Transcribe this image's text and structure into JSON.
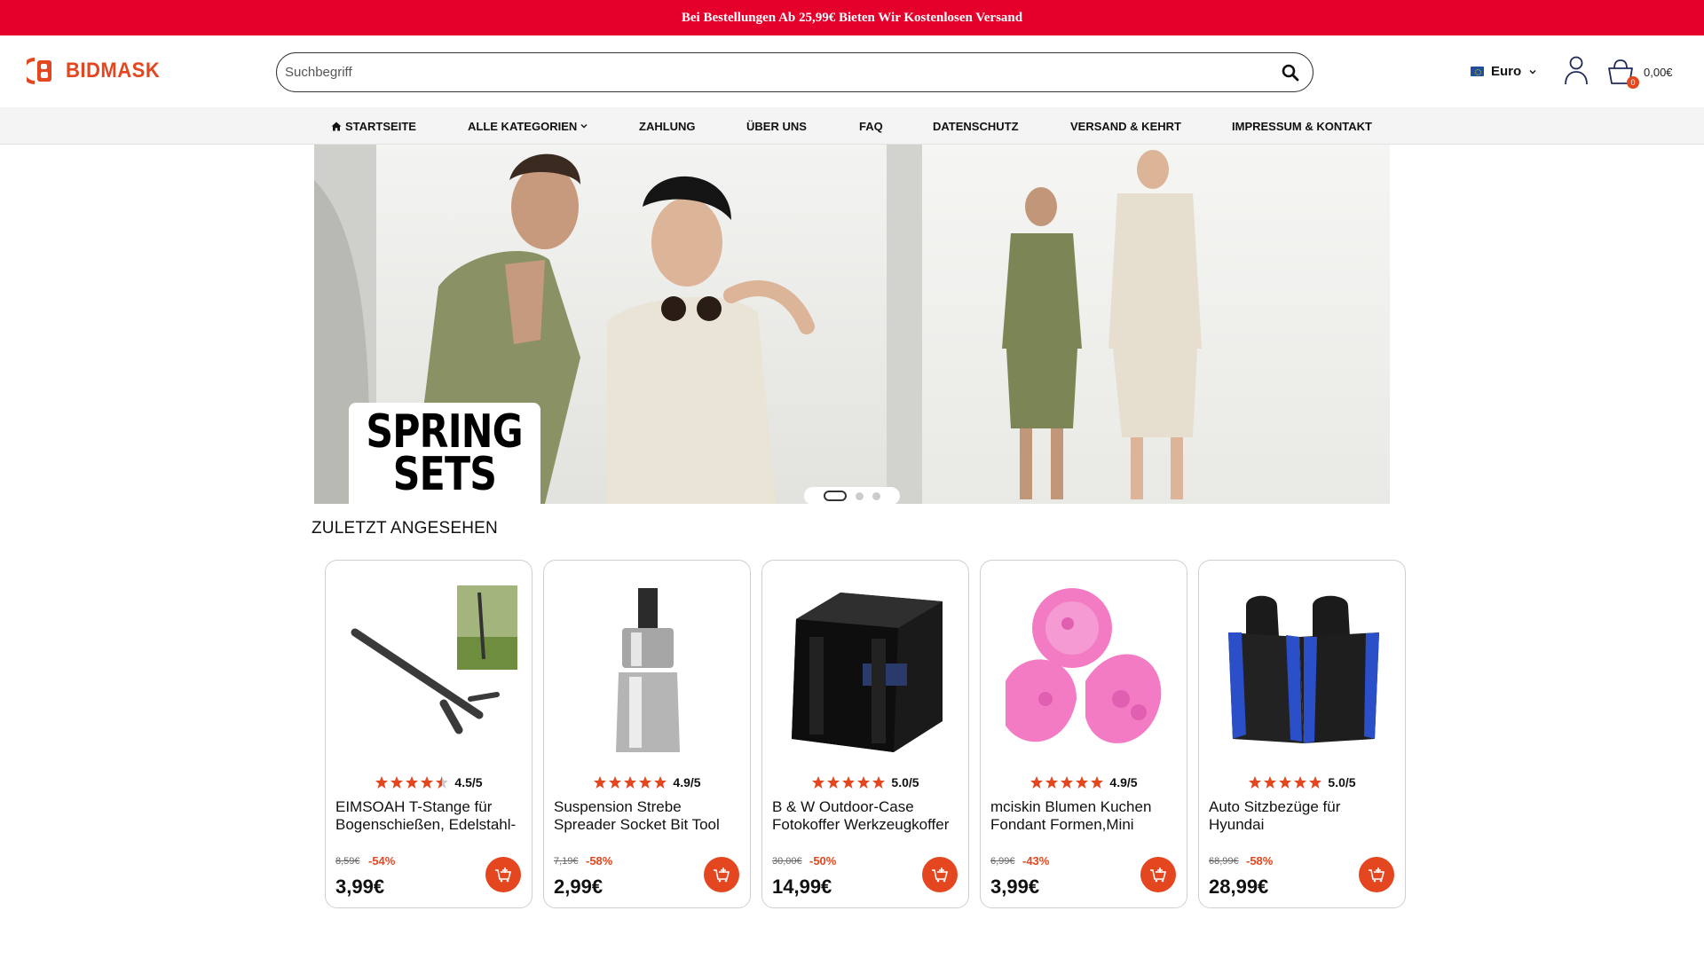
{
  "announcement": "Bei Bestellungen Ab 25,99€ Bieten Wir Kostenlosen Versand",
  "brand": {
    "name": "BIDMASK",
    "color": "#e4461f"
  },
  "search": {
    "placeholder": "Suchbegriff"
  },
  "currency": {
    "label": "Euro"
  },
  "cart": {
    "count": "0",
    "total": "0,00€"
  },
  "nav": [
    {
      "label": "STARTSEITE",
      "icon": "home-icon"
    },
    {
      "label": "ALLE KATEGORIEN",
      "icon": "chevron-down-icon"
    },
    {
      "label": "ZAHLUNG"
    },
    {
      "label": "ÜBER UNS"
    },
    {
      "label": "FAQ"
    },
    {
      "label": "DATENSCHUTZ"
    },
    {
      "label": "VERSAND & KEHRT"
    },
    {
      "label": "IMPRESSUM & KONTAKT"
    }
  ],
  "hero": {
    "badge_line1": "SPRING",
    "badge_line2": "SETS",
    "slides": 3,
    "active_slide": 1
  },
  "recent": {
    "title": "ZULETZT ANGESEHEN",
    "products": [
      {
        "name": "EIMSOAH T-Stange für Bogenschießen, Edelstahl-",
        "rating": 4.5,
        "rating_label": "4.5/5",
        "old_price": "8,59€",
        "discount": "-54%",
        "price": "3,99€",
        "image": "t-bar-tool-image"
      },
      {
        "name": "Suspension Strebe Spreader Socket Bit Tool",
        "rating": 4.9,
        "rating_label": "4.9/5",
        "old_price": "7,19€",
        "discount": "-58%",
        "price": "2,99€",
        "image": "socket-bit-image"
      },
      {
        "name": "B & W Outdoor-Case Fotokoffer Werkzeugkoffer",
        "rating": 5.0,
        "rating_label": "5.0/5",
        "old_price": "30,00€",
        "discount": "-50%",
        "price": "14,99€",
        "image": "hard-case-image"
      },
      {
        "name": "mciskin Blumen Kuchen Fondant Formen,Mini",
        "rating": 4.9,
        "rating_label": "4.9/5",
        "old_price": "6,99€",
        "discount": "-43%",
        "price": "3,99€",
        "image": "silicone-mold-image"
      },
      {
        "name": "Auto Sitzbezüge für Hyundai",
        "rating": 5.0,
        "rating_label": "5.0/5",
        "old_price": "68,99€",
        "discount": "-58%",
        "price": "28,99€",
        "image": "car-seat-cover-image"
      }
    ]
  }
}
